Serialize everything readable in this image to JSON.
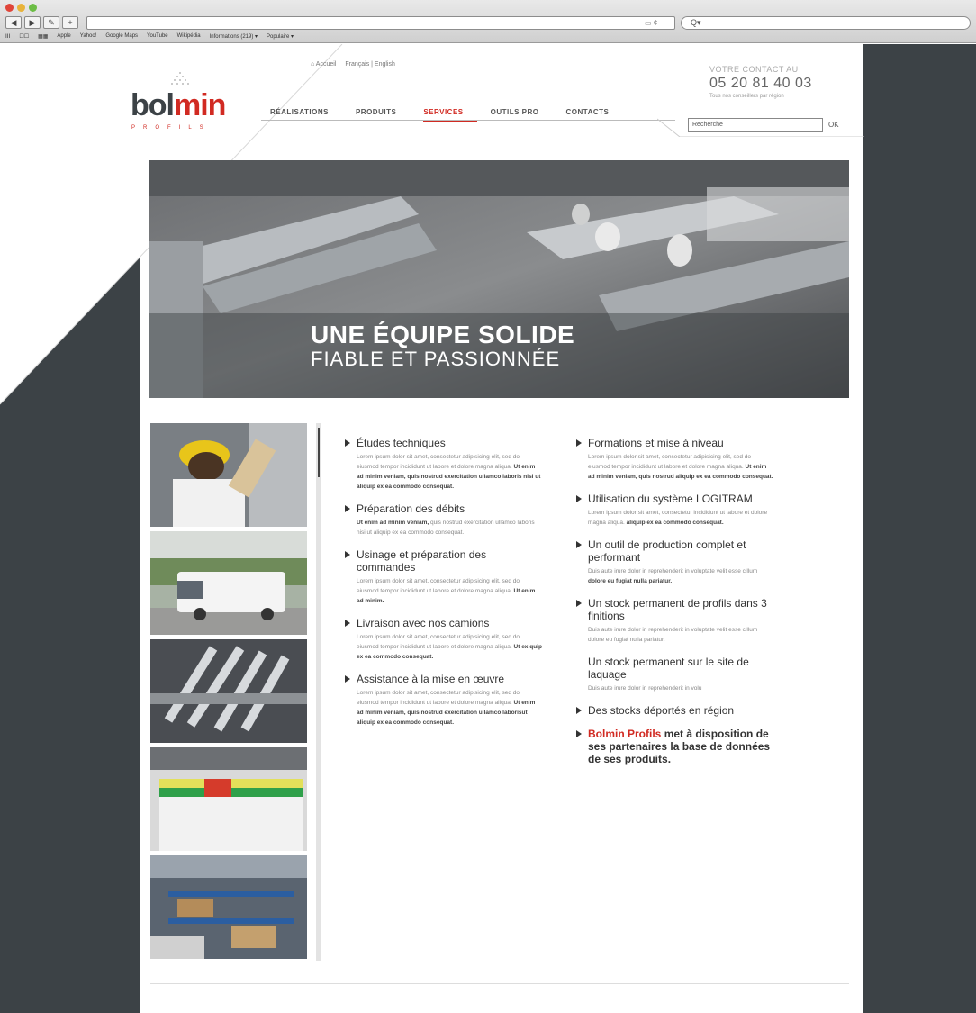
{
  "browser": {
    "search_placeholder": "Q▾",
    "bookmarks": [
      "ⅠⅠⅠ",
      "☐☐",
      "▦▦",
      "Apple",
      "Yahoo!",
      "Google Maps",
      "YouTube",
      "Wikipédia",
      "Informations (219) ▾",
      "Populaire ▾"
    ]
  },
  "header": {
    "logo_main": "bol",
    "logo_accent": "min",
    "logo_sub": "PROFILS",
    "top_links": [
      "⌂ Accueil",
      "Français | English"
    ],
    "nav": [
      {
        "label": "RÉALISATIONS",
        "active": false
      },
      {
        "label": "PRODUITS",
        "active": false
      },
      {
        "label": "SERVICES",
        "active": true
      },
      {
        "label": "OUTILS PRO",
        "active": false
      },
      {
        "label": "CONTACTS",
        "active": false
      }
    ],
    "contact_label": "VOTRE CONTACT AU",
    "contact_phone": "05 20 81 40 03",
    "contact_sub": "Tous nos conseillers par région",
    "search_value": "Recherche",
    "ok_label": "OK"
  },
  "hero": {
    "title": "UNE ÉQUIPE SOLIDE",
    "subtitle": "FIABLE ET PASSIONNÉE"
  },
  "left_items": [
    {
      "title": "Études techniques",
      "text": "Lorem ipsum dolor sit amet, consectetur adipisicing elit, sed do eiusmod tempor incididunt ut labore et dolore magna aliqua.",
      "bold": "Ut enim ad minim veniam, quis nostrud exercitation ullamco laboris nisi ut aliquip ex ea commodo consequat."
    },
    {
      "title": "Préparation des débits",
      "text": "quis nostrud exercitation ullamco laboris nisi ut aliquip ex ea commodo consequat.",
      "bold": "Ut enim ad minim veniam,"
    },
    {
      "title": "Usinage et préparation des commandes",
      "text": "Lorem ipsum dolor sit amet, consectetur adipisicing elit, sed do eiusmod tempor incididunt ut labore et dolore magna aliqua.",
      "bold": "Ut enim ad minim."
    },
    {
      "title": "Livraison avec nos camions",
      "text": "Lorem ipsum dolor sit amet, consectetur adipisicing elit, sed do eiusmod tempor incididunt ut labore et dolore magna aliqua.",
      "bold": "Ut ex quip ex ea commodo consequat."
    },
    {
      "title": "Assistance à la mise en œuvre",
      "text": "Lorem ipsum dolor sit amet, consectetur adipisicing elit, sed do eiusmod tempor incididunt ut labore et dolore magna aliqua.",
      "bold": "Ut enim ad minim veniam, quis nostrud exercitation ullamco laborisut aliquip ex ea commodo consequat."
    }
  ],
  "right_items": [
    {
      "title": "Formations et mise à niveau",
      "text": "Lorem ipsum dolor sit amet, consectetur adipisicing elit, sed do eiusmod tempor incididunt ut labore et dolore magna aliqua.",
      "bold": "Ut enim ad minim veniam, quis nostrud aliquip ex ea commodo consequat."
    },
    {
      "title": "Utilisation du système LOGITRAM",
      "text": "Lorem ipsum dolor sit amet, consectetur incididunt ut labore et dolore magna aliqua.",
      "bold": "aliquip ex ea commodo consequat."
    },
    {
      "title": "Un outil de production complet et performant",
      "text": "Duis aute irure dolor in reprehenderit in voluptate velit esse cillum",
      "bold": "dolore eu fugiat nulla pariatur."
    },
    {
      "title": "Un stock permanent de profils dans 3 finitions",
      "text": "Duis aute irure dolor in reprehenderit in voluptate velit esse cillum dolore eu fugiat nulla pariatur.",
      "bold": ""
    }
  ],
  "plain_item": {
    "title": "Un stock permanent sur le site de laquage",
    "text": "Duis aute irure dolor in reprehenderit in volu"
  },
  "stocks_item": {
    "title": "Des stocks déportés en région"
  },
  "final_item": {
    "brand": "Bolmin Profils",
    "rest": "met à disposition de ses partenaires la base de données de ses produits."
  }
}
